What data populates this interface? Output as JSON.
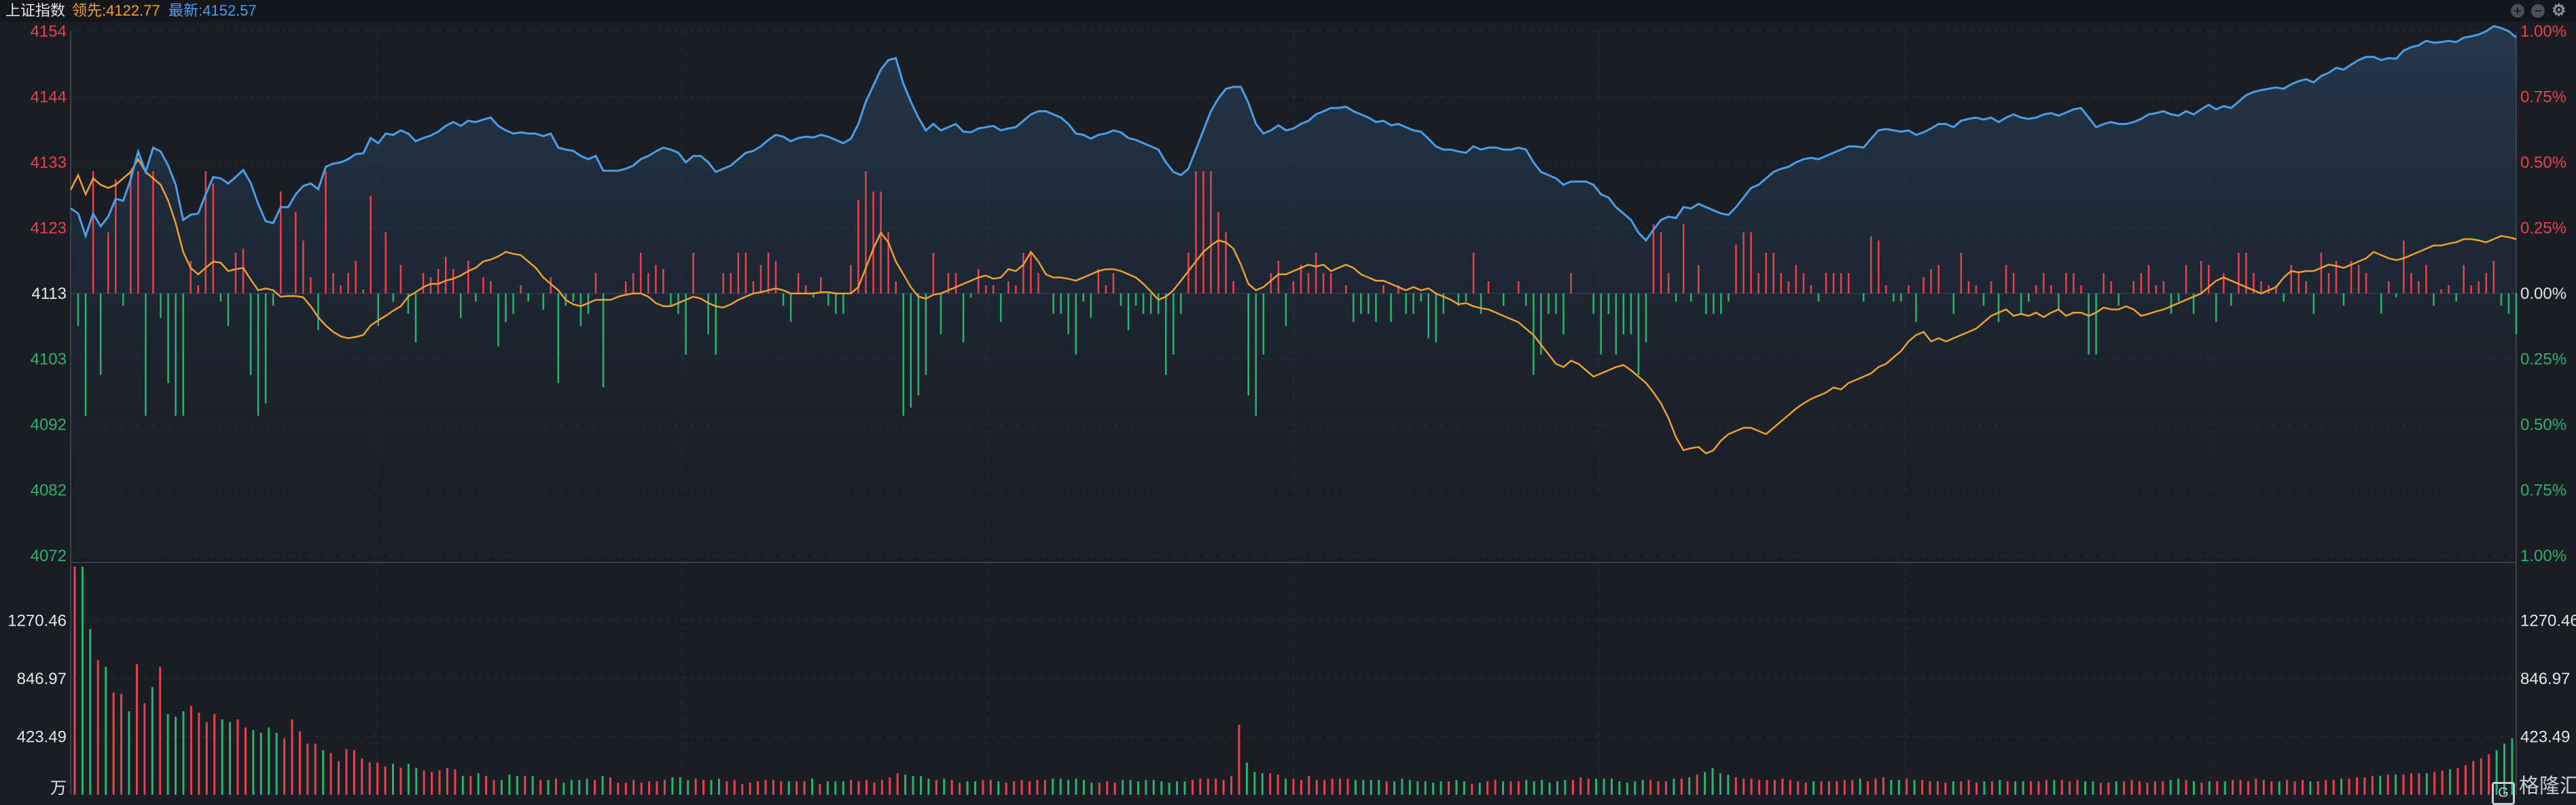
{
  "header": {
    "title": "上证指数",
    "lead_label": "领先:4122.77",
    "latest_label": "最新:4152.57",
    "controls": [
      "plus-icon",
      "minus-icon",
      "gear-icon"
    ]
  },
  "colors": {
    "background": "#1a1d24",
    "up": "#e8414e",
    "down": "#28b46e",
    "latest_line": "#4a9ee8",
    "lead_line": "#f0a030",
    "neutral": "#e6e6e6"
  },
  "watermark": {
    "box": "G",
    "text": "格隆汇"
  },
  "chart_data": {
    "type": "line",
    "title": "上证指数",
    "price_axis": {
      "ticks": [
        "4154",
        "4144",
        "4133",
        "4123",
        "4113",
        "4103",
        "4092",
        "4082",
        "4072"
      ],
      "range": [
        4072,
        4154
      ],
      "base": 4113
    },
    "pct_axis": {
      "ticks": [
        "1.00%",
        "0.75%",
        "0.50%",
        "0.25%",
        "0.00%",
        "0.25%",
        "0.50%",
        "0.75%",
        "1.00%"
      ]
    },
    "volume_axis": {
      "ticks": [
        "1270.46",
        "846.97",
        "423.49"
      ],
      "unit": "万",
      "max": 1693.95
    },
    "series": [
      {
        "name": "最新",
        "values": [
          4126.3,
          4125.5,
          4122.0,
          4125.5,
          4123.5,
          4125.0,
          4127.8,
          4127.5,
          4130.8,
          4135.2,
          4132.0,
          4135.8,
          4135.2,
          4133.0,
          4130.0,
          4124.5,
          4125.3,
          4125.5,
          4128.5,
          4131.2,
          4131.0,
          4130.2,
          4131.2,
          4132.3,
          4130.3,
          4127.0,
          4124.3,
          4124.0,
          4126.5,
          4126.5,
          4128.5,
          4129.8,
          4130.2,
          4129.3,
          4132.8,
          4133.3,
          4133.5,
          4134.0,
          4134.8,
          4134.9,
          4137.3,
          4136.5,
          4138.0,
          4137.8,
          4138.5,
          4138.0,
          4136.8,
          4137.3,
          4137.7,
          4138.3,
          4139.2,
          4139.8,
          4139.2,
          4140.0,
          4139.8,
          4140.2,
          4140.5,
          4139.2,
          4138.5,
          4138.0,
          4138.2,
          4138.0,
          4138.0,
          4137.6,
          4138.0,
          4135.8,
          4135.5,
          4135.3,
          4134.5,
          4134.0,
          4134.5,
          4132.2,
          4132.2,
          4132.2,
          4132.5,
          4133.0,
          4134.0,
          4134.5,
          4135.2,
          4135.8,
          4135.5,
          4135.0,
          4133.5,
          4134.5,
          4134.5,
          4133.5,
          4132.0,
          4132.5,
          4133.0,
          4134.0,
          4135.0,
          4135.3,
          4136.0,
          4137.0,
          4137.8,
          4137.5,
          4136.8,
          4137.3,
          4137.5,
          4137.4,
          4137.8,
          4137.5,
          4137.0,
          4136.5,
          4137.2,
          4139.5,
          4143.0,
          4145.5,
          4148.0,
          4149.5,
          4149.8,
          4145.8,
          4143.0,
          4140.5,
          4138.5,
          4139.5,
          4138.5,
          4139.0,
          4139.5,
          4138.3,
          4138.2,
          4138.8,
          4139.0,
          4139.2,
          4138.5,
          4138.8,
          4139.0,
          4140.0,
          4141.0,
          4141.5,
          4141.5,
          4141.0,
          4140.5,
          4139.5,
          4138.0,
          4137.8,
          4137.2,
          4137.8,
          4138.0,
          4138.5,
          4138.2,
          4137.3,
          4137.0,
          4136.5,
          4136.0,
          4135.5,
          4133.5,
          4132.0,
          4131.5,
          4132.5,
          4135.5,
          4138.5,
          4141.5,
          4143.5,
          4145.0,
          4145.3,
          4145.3,
          4142.8,
          4139.5,
          4138.0,
          4138.5,
          4139.3,
          4138.5,
          4138.8,
          4139.5,
          4140.0,
          4141.0,
          4141.5,
          4142.0,
          4142.0,
          4142.2,
          4141.5,
          4141.0,
          4140.5,
          4139.8,
          4140.0,
          4139.3,
          4139.5,
          4139.0,
          4138.5,
          4138.3,
          4137.2,
          4136.0,
          4135.5,
          4135.5,
          4135.2,
          4135.0,
          4136.0,
          4135.5,
          4135.8,
          4135.8,
          4135.5,
          4135.5,
          4135.8,
          4135.5,
          4133.5,
          4132.0,
          4131.5,
          4131.0,
          4130.0,
          4130.5,
          4130.5,
          4130.5,
          4130.0,
          4128.5,
          4128.0,
          4126.5,
          4125.5,
          4124.5,
          4122.5,
          4121.3,
          4123.0,
          4124.5,
          4125.0,
          4124.8,
          4126.5,
          4126.3,
          4127.0,
          4126.5,
          4126.0,
          4125.5,
          4125.3,
          4126.5,
          4128.0,
          4129.5,
          4130.0,
          4131.0,
          4132.0,
          4132.5,
          4132.8,
          4133.5,
          4134.0,
          4134.2,
          4134.0,
          4134.5,
          4135.0,
          4135.5,
          4136.0,
          4136.0,
          4135.8,
          4137.2,
          4138.5,
          4138.7,
          4138.5,
          4138.3,
          4138.5,
          4137.8,
          4138.2,
          4138.8,
          4139.5,
          4139.5,
          4139.0,
          4140.0,
          4140.3,
          4140.5,
          4140.2,
          4140.5,
          4139.8,
          4140.5,
          4141.0,
          4140.5,
          4140.3,
          4140.5,
          4141.0,
          4141.2,
          4140.8,
          4141.3,
          4141.8,
          4142.0,
          4140.5,
          4139.0,
          4139.5,
          4139.8,
          4139.5,
          4139.5,
          4139.8,
          4140.3,
          4141.0,
          4141.2,
          4141.5,
          4141.0,
          4140.8,
          4141.5,
          4141.0,
          4141.8,
          4142.5,
          4141.8,
          4142.3,
          4142.0,
          4143.0,
          4144.0,
          4144.5,
          4144.8,
          4145.0,
          4145.2,
          4145.0,
          4145.7,
          4146.2,
          4146.5,
          4146.0,
          4147.0,
          4147.5,
          4148.3,
          4148.0,
          4148.8,
          4149.5,
          4150.0,
          4150.0,
          4149.5,
          4149.8,
          4149.7,
          4151.0,
          4151.5,
          4151.8,
          4152.5,
          4152.2,
          4152.3,
          4152.5,
          4152.3,
          4153.0,
          4153.2,
          4153.5,
          4154.0,
          4154.8,
          4154.5,
          4154.0,
          4153.0
        ]
      },
      {
        "name": "领先",
        "values": [
          4129.2,
          4131.5,
          4128.5,
          4131.0,
          4130.0,
          4129.5,
          4130.0,
          4131.0,
          4132.0,
          4134.0,
          4132.0,
          4131.0,
          4130.0,
          4127.5,
          4124.0,
          4119.5,
          4117.0,
          4116.0,
          4117.0,
          4118.0,
          4117.8,
          4116.5,
          4116.8,
          4117.0,
          4115.2,
          4113.5,
          4113.8,
          4113.5,
          4112.5,
          4112.6,
          4112.6,
          4112.4,
          4111.0,
          4109.3,
          4108.0,
          4107.0,
          4106.3,
          4106.0,
          4106.2,
          4106.5,
          4108.0,
          4108.8,
          4109.5,
          4110.3,
          4111.0,
          4112.5,
          4113.2,
          4114.0,
          4114.5,
          4114.5,
          4115.0,
          4115.3,
          4115.8,
          4116.5,
          4117.0,
          4118.0,
          4118.3,
          4118.8,
          4119.5,
          4119.2,
          4119.0,
          4118.0,
          4117.0,
          4115.5,
          4114.5,
          4113.5,
          4112.0,
          4111.3,
          4111.0,
          4111.5,
          4112.0,
          4112.0,
          4112.0,
          4112.5,
          4112.8,
          4113.0,
          4113.0,
          4112.5,
          4111.5,
          4111.0,
          4111.0,
          4111.5,
          4112.0,
          4112.5,
          4112.2,
          4111.5,
          4111.0,
          4110.8,
          4111.3,
          4112.0,
          4112.5,
          4113.0,
          4113.2,
          4113.5,
          4113.8,
          4113.5,
          4113.0,
          4113.0,
          4113.0,
          4113.0,
          4113.2,
          4113.2,
          4113.0,
          4113.0,
          4113.0,
          4114.0,
          4117.0,
          4120.0,
          4122.5,
          4121.0,
          4118.0,
          4116.0,
          4114.0,
          4112.5,
          4112.2,
          4112.8,
          4113.0,
          4113.5,
          4114.0,
          4114.5,
          4115.0,
          4115.5,
          4115.8,
          4115.3,
          4115.5,
          4116.8,
          4116.5,
          4117.5,
          4119.5,
          4118.0,
          4116.0,
          4115.5,
          4115.5,
          4115.3,
          4115.0,
          4115.5,
          4116.0,
          4116.5,
          4116.8,
          4116.8,
          4116.5,
          4116.0,
          4115.5,
          4114.5,
          4113.3,
          4112.0,
          4112.5,
          4113.5,
          4115.0,
          4116.5,
          4118.0,
          4119.5,
          4120.5,
          4121.3,
          4121.0,
          4120.0,
          4117.5,
          4114.5,
          4113.5,
          4114.0,
          4115.0,
          4116.0,
          4116.0,
          4116.5,
          4117.0,
          4117.5,
          4117.2,
          4117.5,
          4116.5,
          4117.0,
          4117.5,
          4117.0,
          4116.0,
          4115.5,
          4115.0,
          4115.0,
          4114.5,
          4114.0,
          4113.5,
          4114.0,
          4113.5,
          4113.8,
          4113.0,
          4112.5,
          4112.0,
          4111.3,
          4111.5,
          4111.0,
          4110.7,
          4110.5,
          4110.0,
          4109.5,
          4109.0,
          4108.5,
          4107.5,
          4106.5,
          4105.0,
          4103.5,
          4102.0,
          4101.5,
          4102.5,
          4102.0,
          4101.0,
          4100.0,
          4100.5,
          4101.0,
          4101.5,
          4101.8,
          4101.0,
          4100.0,
          4099.0,
          4097.5,
          4095.8,
          4093.5,
          4090.5,
          4088.5,
          4088.8,
          4089.0,
          4088.0,
          4088.5,
          4090.0,
          4091.0,
          4091.5,
          4092.0,
          4092.0,
          4091.5,
          4091.0,
          4092.0,
          4093.0,
          4094.0,
          4095.0,
          4095.8,
          4096.5,
          4097.0,
          4097.5,
          4098.3,
          4098.0,
          4099.0,
          4099.5,
          4100.0,
          4100.5,
          4101.5,
          4102.0,
          4103.0,
          4104.0,
          4105.5,
          4106.5,
          4107.0,
          4105.5,
          4106.0,
          4105.5,
          4106.0,
          4106.5,
          4107.0,
          4107.5,
          4108.5,
          4109.5,
          4110.0,
          4110.5,
          4109.5,
          4109.8,
          4109.5,
          4110.0,
          4109.3,
          4110.0,
          4110.5,
          4109.5,
          4110.0,
          4110.0,
          4109.5,
          4110.0,
          4110.8,
          4110.5,
          4110.5,
          4111.0,
          4110.5,
          4109.5,
          4109.8,
          4110.2,
          4110.5,
          4111.0,
          4111.5,
          4112.0,
          4112.5,
          4113.0,
          4114.0,
          4115.0,
          4115.5,
          4115.0,
          4114.5,
          4114.0,
          4113.5,
          4113.0,
          4113.5,
          4114.0,
          4115.5,
          4116.5,
          4116.3,
          4116.5,
          4116.5,
          4117.0,
          4117.5,
          4117.3,
          4117.0,
          4117.5,
          4118.0,
          4118.5,
          4119.5,
          4119.0,
          4118.5,
          4118.2,
          4118.5,
          4119.0,
          4119.5,
          4120.0,
          4120.5,
          4120.5,
          4120.8,
          4121.0,
          4121.5,
          4121.5,
          4121.3,
          4121.0,
          4121.5,
          4122.0,
          4121.8,
          4121.5,
          4121.7,
          4121.5,
          4122.0,
          4123.0,
          4123.5,
          4123.5,
          4123.0,
          4122.8
        ]
      }
    ],
    "volume": [
      1693.95,
      1693.95,
      1230,
      1000,
      950,
      760,
      750,
      620,
      970,
      680,
      800,
      950,
      600,
      580,
      620,
      660,
      610,
      540,
      600,
      560,
      540,
      560,
      500,
      480,
      460,
      500,
      460,
      420,
      560,
      470,
      380,
      380,
      330,
      310,
      250,
      340,
      330,
      270,
      240,
      240,
      210,
      230,
      200,
      230,
      200,
      180,
      170,
      180,
      200,
      190,
      140,
      140,
      160,
      140,
      110,
      110,
      150,
      140,
      140,
      140,
      110,
      110,
      120,
      90,
      110,
      110,
      120,
      110,
      140,
      130,
      90,
      90,
      110,
      90,
      100,
      100,
      110,
      130,
      130,
      110,
      120,
      110,
      110,
      120,
      100,
      110,
      80,
      90,
      100,
      110,
      110,
      100,
      100,
      100,
      100,
      120,
      80,
      100,
      100,
      100,
      110,
      100,
      110,
      90,
      110,
      130,
      160,
      150,
      140,
      140,
      120,
      110,
      120,
      110,
      90,
      100,
      100,
      110,
      110,
      100,
      90,
      100,
      110,
      100,
      110,
      110,
      120,
      120,
      110,
      120,
      110,
      90,
      90,
      100,
      90,
      110,
      110,
      100,
      110,
      110,
      100,
      90,
      100,
      100,
      110,
      120,
      120,
      120,
      110,
      140,
      520,
      240,
      170,
      160,
      160,
      150,
      120,
      120,
      110,
      140,
      110,
      110,
      120,
      120,
      120,
      110,
      110,
      110,
      110,
      100,
      100,
      120,
      110,
      100,
      100,
      90,
      100,
      100,
      110,
      100,
      80,
      90,
      100,
      110,
      100,
      100,
      100,
      110,
      100,
      110,
      90,
      100,
      110,
      110,
      130,
      120,
      120,
      120,
      120,
      100,
      90,
      100,
      110,
      110,
      100,
      100,
      120,
      120,
      130,
      150,
      170,
      200,
      160,
      150,
      130,
      120,
      120,
      110,
      110,
      110,
      120,
      110,
      100,
      90,
      100,
      100,
      100,
      100,
      110,
      110,
      120,
      100,
      120,
      130,
      110,
      110,
      120,
      110,
      110,
      100,
      100,
      90,
      100,
      100,
      110,
      90,
      100,
      100,
      110,
      100,
      100,
      100,
      100,
      100,
      110,
      110,
      110,
      100,
      110,
      100,
      100,
      90,
      90,
      100,
      100,
      110,
      100,
      90,
      100,
      100,
      110,
      120,
      110,
      100,
      90,
      100,
      100,
      100,
      110,
      110,
      100,
      120,
      110,
      100,
      100,
      110,
      100,
      110,
      100,
      100,
      110,
      110,
      120,
      120,
      130,
      130,
      140,
      140,
      150,
      150,
      150,
      160,
      160,
      160,
      170,
      180,
      190,
      200,
      220,
      250,
      270,
      300,
      330,
      380,
      420
    ]
  }
}
